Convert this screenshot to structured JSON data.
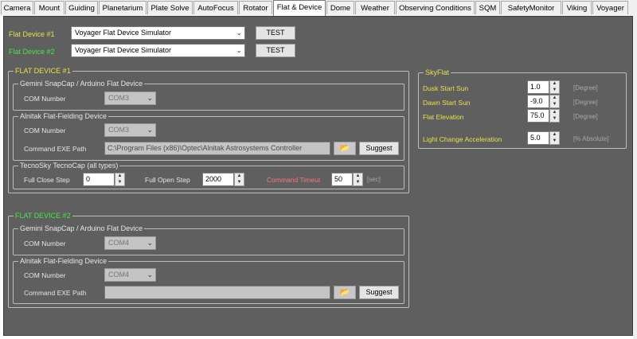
{
  "tabs": [
    "Camera",
    "Mount",
    "Guiding",
    "Planetarium",
    "Plate Solve",
    "AutoFocus",
    "Rotator",
    "Flat & Device",
    "Dome",
    "Weather",
    "Observing Conditions",
    "SQM",
    "SafetyMonitor",
    "Viking",
    "Voyager"
  ],
  "active_tab": "Flat & Device",
  "top": {
    "flat1_label": "Flat Device #1",
    "flat1_value": "Voyager Flat Device Simulator",
    "flat2_label": "Flat Device #2",
    "flat2_value": "Voyager Flat Device Simulator",
    "test_label": "TEST"
  },
  "flat_device_1": {
    "title": "FLAT DEVICE #1",
    "gemini": {
      "title": "Gemini SnapCap / Arduino Flat Device",
      "com_label": "COM Number",
      "com_value": "COM3"
    },
    "alnitak": {
      "title": "Alnitak Flat-Fielding Device",
      "com_label": "COM Number",
      "com_value": "COM3",
      "exe_label": "Command EXE Path",
      "exe_value": "C:\\Program Files (x86)\\Optec\\Alnitak Astrosystems Controller",
      "suggest_label": "Suggest"
    },
    "tecnosky": {
      "title": "TecnoSky TecnoCap (all types)",
      "close_label": "Full Close Step",
      "close_value": "0",
      "open_label": "Full Open Step",
      "open_value": "2000",
      "timeout_label": "Command Timeut",
      "timeout_value": "50",
      "timeout_unit": "[sec]"
    }
  },
  "flat_device_2": {
    "title": "FLAT DEVICE #2",
    "gemini": {
      "title": "Gemini SnapCap / Arduino Flat Device",
      "com_label": "COM Number",
      "com_value": "COM4"
    },
    "alnitak": {
      "title": "Alnitak Flat-Fielding Device",
      "com_label": "COM Number",
      "com_value": "COM4",
      "exe_label": "Command EXE Path",
      "exe_value": "",
      "suggest_label": "Suggest"
    }
  },
  "skyflat": {
    "title": "SkyFlat",
    "dusk_label": "Dusk Start Sun",
    "dusk_value": "1.0",
    "dawn_label": "Dawn Start Sun",
    "dawn_value": "-9.0",
    "elev_label": "Flat Elevation",
    "elev_value": "75.0",
    "accel_label": "Light Change Acceleration",
    "accel_value": "5.0",
    "degree_unit": "[Degree]",
    "percent_unit": "[% Absolute]"
  },
  "icons": {
    "dropdown": "chevron-down-icon",
    "folder": "folder-icon",
    "spin_up": "arrow-up-icon",
    "spin_down": "arrow-down-icon"
  },
  "colors": {
    "panel": "#5f5f5f",
    "yellow_label": "#e8e04a",
    "green_label": "#45e545",
    "red_label": "#ff7575"
  }
}
